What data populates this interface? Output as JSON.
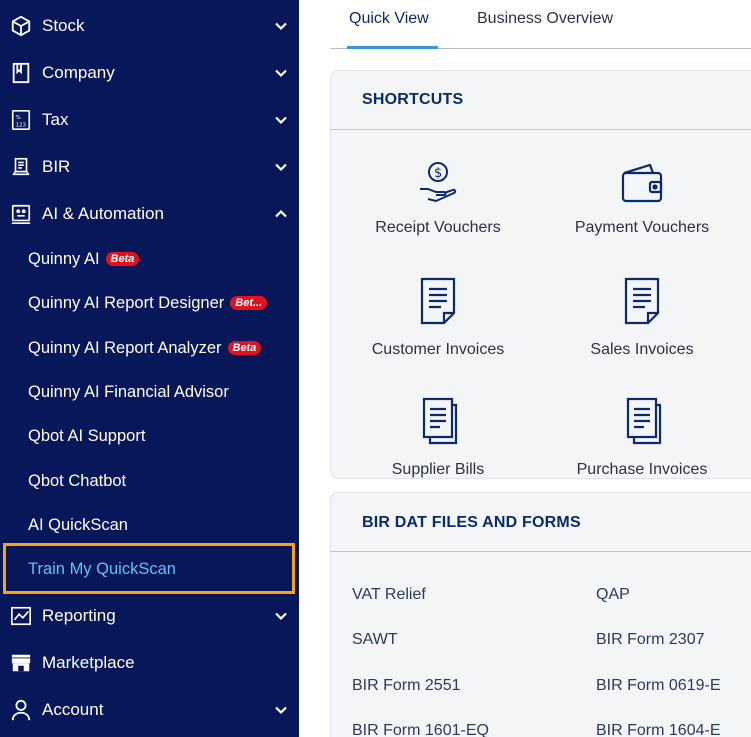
{
  "sidebar": {
    "items": [
      {
        "label": "Stock",
        "icon": "box-icon",
        "chevron": "down"
      },
      {
        "label": "Company",
        "icon": "book-icon",
        "chevron": "down"
      },
      {
        "label": "Tax",
        "icon": "calculator-icon",
        "chevron": "down"
      },
      {
        "label": "BIR",
        "icon": "document-stack-icon",
        "chevron": "down"
      },
      {
        "label": "AI & Automation",
        "icon": "robot-icon",
        "chevron": "up"
      }
    ],
    "sub_items": [
      {
        "label": "Quinny AI",
        "badge": "Beta"
      },
      {
        "label": "Quinny AI Report Designer",
        "badge": "Bet..."
      },
      {
        "label": "Quinny AI Report Analyzer",
        "badge": "Beta"
      },
      {
        "label": "Quinny AI Financial Advisor",
        "badge": ""
      },
      {
        "label": "Qbot AI Support",
        "badge": ""
      },
      {
        "label": "Qbot Chatbot",
        "badge": ""
      },
      {
        "label": "AI QuickScan",
        "badge": ""
      },
      {
        "label": "Train My QuickScan",
        "badge": "",
        "active": true
      }
    ],
    "bottom_items": [
      {
        "label": "Reporting",
        "icon": "chart-icon",
        "chevron": "down"
      },
      {
        "label": "Marketplace",
        "icon": "store-icon",
        "chevron": ""
      },
      {
        "label": "Account",
        "icon": "user-icon",
        "chevron": "down"
      }
    ],
    "colors": {
      "background": "#07175a",
      "active_text": "#5ec3f5",
      "highlight": "#f5a516",
      "badge": "#e0121d"
    }
  },
  "tabs": {
    "quick_view": "Quick View",
    "business_overview": "Business Overview"
  },
  "shortcuts": {
    "title": "SHORTCUTS",
    "items": [
      {
        "label": "Receipt Vouchers",
        "icon": "hand-coin-icon"
      },
      {
        "label": "Payment Vouchers",
        "icon": "wallet-icon"
      },
      {
        "label": "Customer Invoices",
        "icon": "invoice-icon"
      },
      {
        "label": "Sales Invoices",
        "icon": "invoice-icon"
      },
      {
        "label": "Supplier Bills",
        "icon": "bills-icon"
      },
      {
        "label": "Purchase Invoices",
        "icon": "bills-icon"
      }
    ]
  },
  "bir": {
    "title": "BIR DAT FILES AND FORMS",
    "links": [
      "VAT Relief",
      "QAP",
      "SAWT",
      "BIR Form 2307",
      "BIR Form 2551",
      "BIR Form 0619-E",
      "BIR Form 1601-EQ",
      "BIR Form 1604-E"
    ]
  }
}
